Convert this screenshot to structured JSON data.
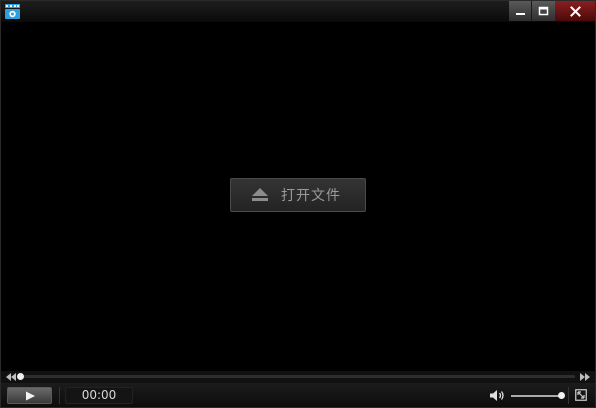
{
  "window": {
    "app_icon": "media-player-app-icon",
    "controls": {
      "minimize_icon": "minimize-icon",
      "maximize_icon": "maximize-icon",
      "close_icon": "close-icon"
    }
  },
  "video": {
    "open_file": {
      "label": "打开文件",
      "icon": "eject-icon"
    }
  },
  "seek": {
    "progress": 0,
    "back_icon": "rewind-icon",
    "forward_icon": "fast-forward-icon"
  },
  "controls": {
    "play_icon": "play-icon",
    "time": "00:00",
    "volume_icon": "speaker-icon",
    "volume_level": 1.0,
    "fullscreen_icon": "fullscreen-icon"
  },
  "colors": {
    "background": "#000000",
    "close_button": "#6a1414",
    "button_text": "#9a9a9a"
  }
}
